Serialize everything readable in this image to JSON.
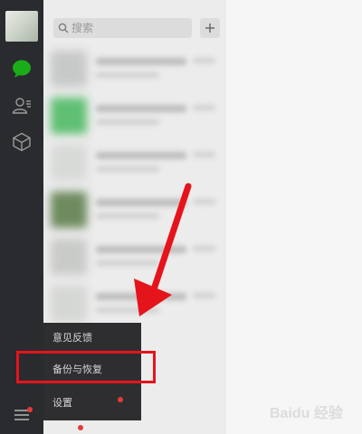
{
  "search": {
    "placeholder": "搜索"
  },
  "popup_menu": {
    "items": [
      {
        "label": "意见反馈"
      },
      {
        "label": "备份与恢复"
      },
      {
        "label": "设置"
      }
    ]
  },
  "watermark": {
    "text": "Baidu 经验"
  },
  "colors": {
    "rail": "#2a2b2e",
    "list_bg": "#ececec",
    "popup_bg": "#2e2e31",
    "accent_green": "#1aad19",
    "highlight_red": "#e5141b",
    "badge_red": "#e53a3a"
  },
  "icons": {
    "chat": "chat-bubble-icon",
    "contacts": "contacts-icon",
    "favorites": "cube-icon",
    "menu": "hamburger-icon",
    "search": "magnifier-icon",
    "add": "plus-icon"
  }
}
